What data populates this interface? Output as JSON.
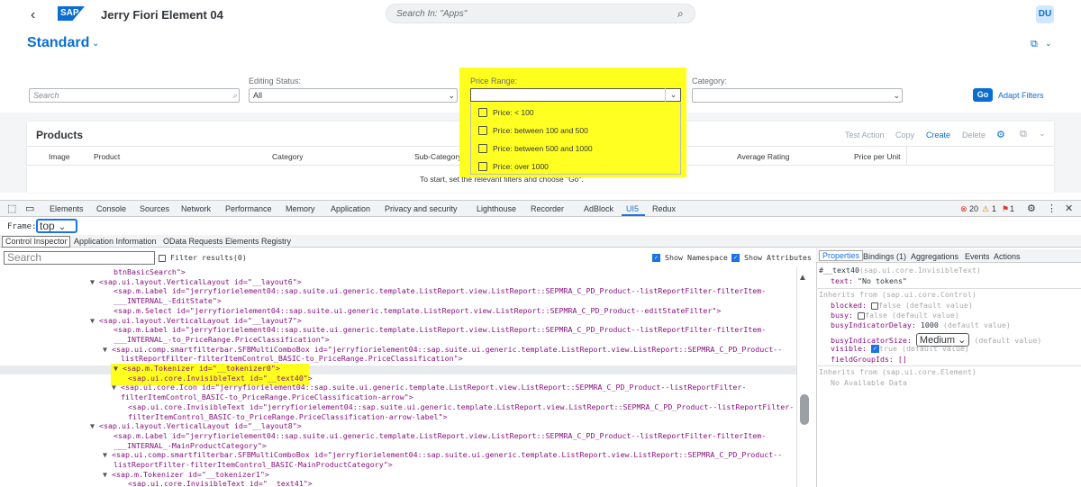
{
  "shell": {
    "logo": "SAP",
    "title": "Jerry Fiori Element 04",
    "search_placeholder": "Search In: \"Apps\"",
    "avatar": "DU"
  },
  "header": {
    "variant": "Standard"
  },
  "filterbar": {
    "search_placeholder": "Search",
    "editing_status_label": "Editing Status:",
    "editing_status_value": "All",
    "price_range_label": "Price Range:",
    "category_label": "Category:",
    "go": "Go",
    "adapt": "Adapt Filters"
  },
  "price_options": [
    "Price: < 100",
    "Price: between 100 and 500",
    "Price: between 500 and 1000",
    "Price: over 1000"
  ],
  "table": {
    "title": "Products",
    "actions": [
      "Test Action",
      "Copy",
      "Create",
      "Delete"
    ],
    "columns": [
      "Image",
      "Product",
      "Category",
      "Sub-Category",
      "Average Rating",
      "Price per Unit"
    ],
    "no_data": "To start, set the relevant filters and choose \"Go\"."
  },
  "devtools": {
    "tabs": [
      "Elements",
      "Console",
      "Sources",
      "Network",
      "Performance",
      "Memory",
      "Application",
      "Privacy and security",
      "Lighthouse",
      "Recorder",
      "AdBlock",
      "UI5",
      "Redux"
    ],
    "errors": "20",
    "warnings": "1",
    "issues": "1",
    "frame_label": "Frame:",
    "frame_value": "top",
    "subtabs": [
      "Control Inspector",
      "Application Information",
      "OData Requests",
      "Elements Registry"
    ],
    "tree_search": "Search",
    "filter_label": "Filter results(0)",
    "show_namespace": "Show Namespace",
    "show_attributes": "Show Attributes",
    "prop_tabs": [
      "Properties",
      "Bindings (1)",
      "Aggregations",
      "Events",
      "Actions"
    ]
  },
  "tree_lines": [
    {
      "tag": "btnBasicSearch\">",
      "indent": 0
    },
    {
      "tag": "<sap.ui.layout.VerticalLayout id=\"__layout6\">",
      "indent": 1
    },
    {
      "tag": "<sap.m.Label id=\"jerryfiorielement04::sap.suite.ui.generic.template.ListReport.view.ListReport::SEPMRA_C_PD_Product--listReportFilter-filterItem-",
      "indent": 2
    },
    {
      "tag": "___INTERNAL_-EditState\">",
      "indent": 2
    },
    {
      "tag": "<sap.m.Select id=\"jerryfiorielement04::sap.suite.ui.generic.template.ListReport.view.ListReport::SEPMRA_C_PD_Product--editStateFilter\">",
      "indent": 2
    },
    {
      "tag": "<sap.ui.layout.VerticalLayout id=\"__layout7\">",
      "indent": 1
    },
    {
      "tag": "<sap.m.Label id=\"jerryfiorielement04::sap.suite.ui.generic.template.ListReport.view.ListReport::SEPMRA_C_PD_Product--listReportFilter-filterItem-",
      "indent": 2
    },
    {
      "tag": "___INTERNAL_-to_PriceRange.PriceClassification\">",
      "indent": 2
    },
    {
      "tag": "<sap.ui.comp.smartfilterbar.SFBMultiComboBox id=\"jerryfiorielement04::sap.suite.ui.generic.template.ListReport.view.ListReport::SEPMRA_C_PD_Product--",
      "indent": 2
    },
    {
      "tag": "listReportFilter-filterItemControl_BASIC-to_PriceRange.PriceClassification\">",
      "indent": 2
    },
    {
      "tag": "<sap.m.Tokenizer id=\"__tokenizer0\">",
      "indent": 3
    },
    {
      "tag": "<sap.ui.core.InvisibleText id=\"__text40\">",
      "indent": 3
    },
    {
      "tag": "<sap.ui.core.Icon id=\"jerryfiorielement04::sap.suite.ui.generic.template.ListReport.view.ListReport::SEPMRA_C_PD_Product--listReportFilter-",
      "indent": 3
    },
    {
      "tag": "filterItemControl_BASIC-to_PriceRange.PriceClassification-arrow\">",
      "indent": 3
    },
    {
      "tag": "<sap.ui.core.InvisibleText id=\"jerryfiorielement04::sap.suite.ui.generic.template.ListReport.view.ListReport::SEPMRA_C_PD_Product--listReportFilter-",
      "indent": 4
    },
    {
      "tag": "filterItemControl_BASIC-to_PriceRange.PriceClassification-arrow-label\">",
      "indent": 4
    },
    {
      "tag": "<sap.ui.layout.VerticalLayout id=\"__layout8\">",
      "indent": 1
    },
    {
      "tag": "<sap.m.Label id=\"jerryfiorielement04::sap.suite.ui.generic.template.ListReport.view.ListReport::SEPMRA_C_PD_Product--listReportFilter-filterItem-",
      "indent": 2
    },
    {
      "tag": "___INTERNAL_-MainProductCategory\">",
      "indent": 2
    },
    {
      "tag": "<sap.ui.comp.smartfilterbar.SFBMultiComboBox id=\"jerryfiorielement04::sap.suite.ui.generic.template.ListReport.view.ListReport::SEPMRA_C_PD_Product--",
      "indent": 2
    },
    {
      "tag": "listReportFilter-filterItemControl_BASIC-MainProductCategory\">",
      "indent": 2
    },
    {
      "tag": "<sap.m.Tokenizer id=\"__tokenizer1\">",
      "indent": 3
    },
    {
      "tag": "<sap.ui.core.InvisibleText id=\"__text41\">",
      "indent": 4
    }
  ],
  "props": {
    "title": "#__text40",
    "title_type": "(sap.ui.core.InvisibleText)",
    "text_key": "text:",
    "text_val": "\"No tokens\"",
    "inherits1": "Inherits from (sap.ui.core.Control)",
    "blocked": "blocked:",
    "busy": "busy:",
    "busyIndicatorDelay": "busyIndicatorDelay:",
    "delay_val": "1000",
    "busyIndicatorSize": "busyIndicatorSize:",
    "size_val": "Medium",
    "visible": "visible:",
    "fieldGroupIds": "fieldGroupIds: []",
    "false_default": "false (default value)",
    "default_value": "(default value)",
    "true_default": "true (default value)",
    "inherits2": "Inherits from (sap.ui.core.Element)",
    "no_data": "No Available Data"
  }
}
